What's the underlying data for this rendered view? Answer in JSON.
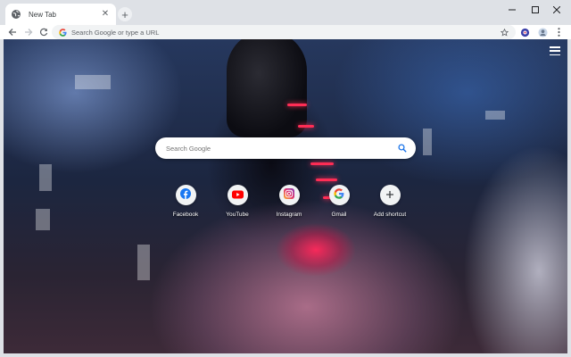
{
  "tab": {
    "title": "New Tab",
    "favicon": "globe-icon",
    "close_glyph": "✕"
  },
  "new_tab_glyph": "+",
  "toolbar": {
    "omnibox_placeholder": "Search Google or type a URL"
  },
  "page": {
    "search_placeholder": "Search Google",
    "shortcuts": [
      {
        "label": "Facebook",
        "icon": "facebook-icon",
        "color": "#1877f2"
      },
      {
        "label": "YouTube",
        "icon": "youtube-icon",
        "color": "#ff0000"
      },
      {
        "label": "Instagram",
        "icon": "instagram-icon",
        "color": "#c13584"
      },
      {
        "label": "Gmail",
        "icon": "google-icon",
        "color": "#4285f4"
      },
      {
        "label": "Add shortcut",
        "icon": "plus-icon",
        "color": "#3c4043"
      }
    ]
  },
  "colors": {
    "accent": "#1a73e8",
    "tab_strip": "#dee1e6",
    "neon": "#ff2d55"
  }
}
